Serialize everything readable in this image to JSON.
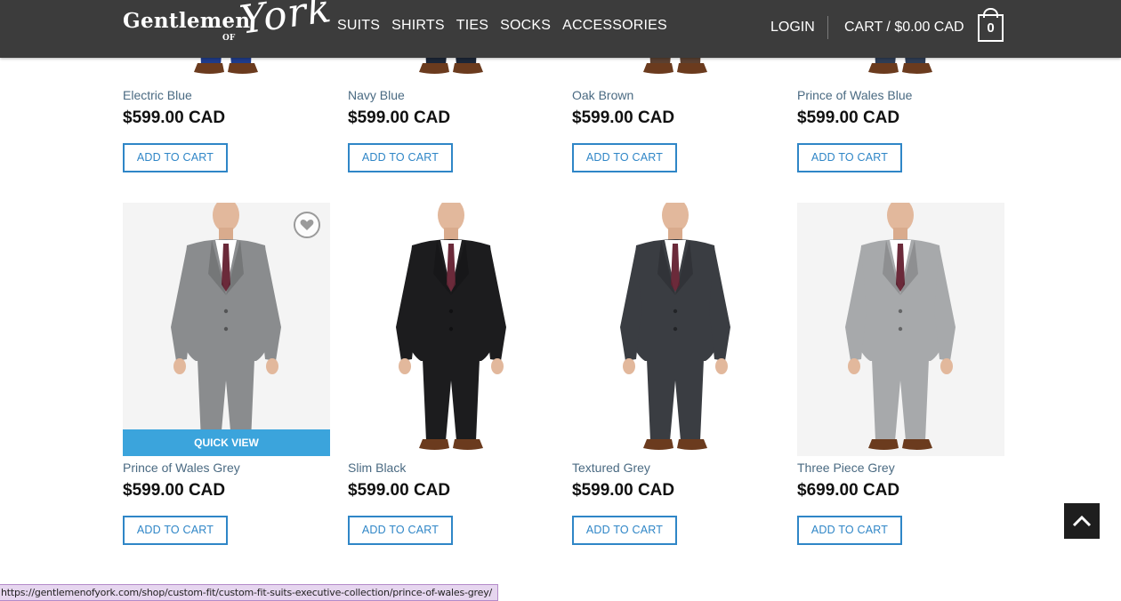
{
  "header": {
    "logo": {
      "word1": "Gentlemen",
      "word2": "OF",
      "word3": "York"
    },
    "nav": [
      "SUITS",
      "SHIRTS",
      "TIES",
      "SOCKS",
      "ACCESSORIES"
    ],
    "login_label": "LOGIN",
    "cart_label": "CART / $0.00 CAD",
    "cart_count": "0"
  },
  "products": [
    {
      "name": "Electric Blue",
      "price": "$599.00 CAD",
      "button": "ADD TO CART",
      "suit_color": "#1f3c8a"
    },
    {
      "name": "Navy Blue",
      "price": "$599.00 CAD",
      "button": "ADD TO CART",
      "suit_color": "#1c2638"
    },
    {
      "name": "Oak Brown",
      "price": "$599.00 CAD",
      "button": "ADD TO CART",
      "suit_color": "#5a4030"
    },
    {
      "name": "Prince of Wales Blue",
      "price": "$599.00 CAD",
      "button": "ADD TO CART",
      "suit_color": "#2e3d55"
    },
    {
      "name": "Prince of Wales Grey",
      "price": "$599.00 CAD",
      "button": "ADD TO CART",
      "suit_color": "#8a8c8e",
      "quick_view": "QUICK VIEW"
    },
    {
      "name": "Slim Black",
      "price": "$599.00 CAD",
      "button": "ADD TO CART",
      "suit_color": "#1c1c1e"
    },
    {
      "name": "Textured Grey",
      "price": "$599.00 CAD",
      "button": "ADD TO CART",
      "suit_color": "#3a3d42"
    },
    {
      "name": "Three Piece Grey",
      "price": "$699.00 CAD",
      "button": "ADD TO CART",
      "suit_color": "#a7a9ab"
    }
  ],
  "status_url": "https://gentlemenofyork.com/shop/custom-fit/custom-fit-suits-executive-collection/prince-of-wales-grey/",
  "colors": {
    "header_bg": "#3c3c3c",
    "accent": "#2f86c7",
    "quick_view_bg": "#3ba4dc",
    "link": "#4a6a82"
  }
}
